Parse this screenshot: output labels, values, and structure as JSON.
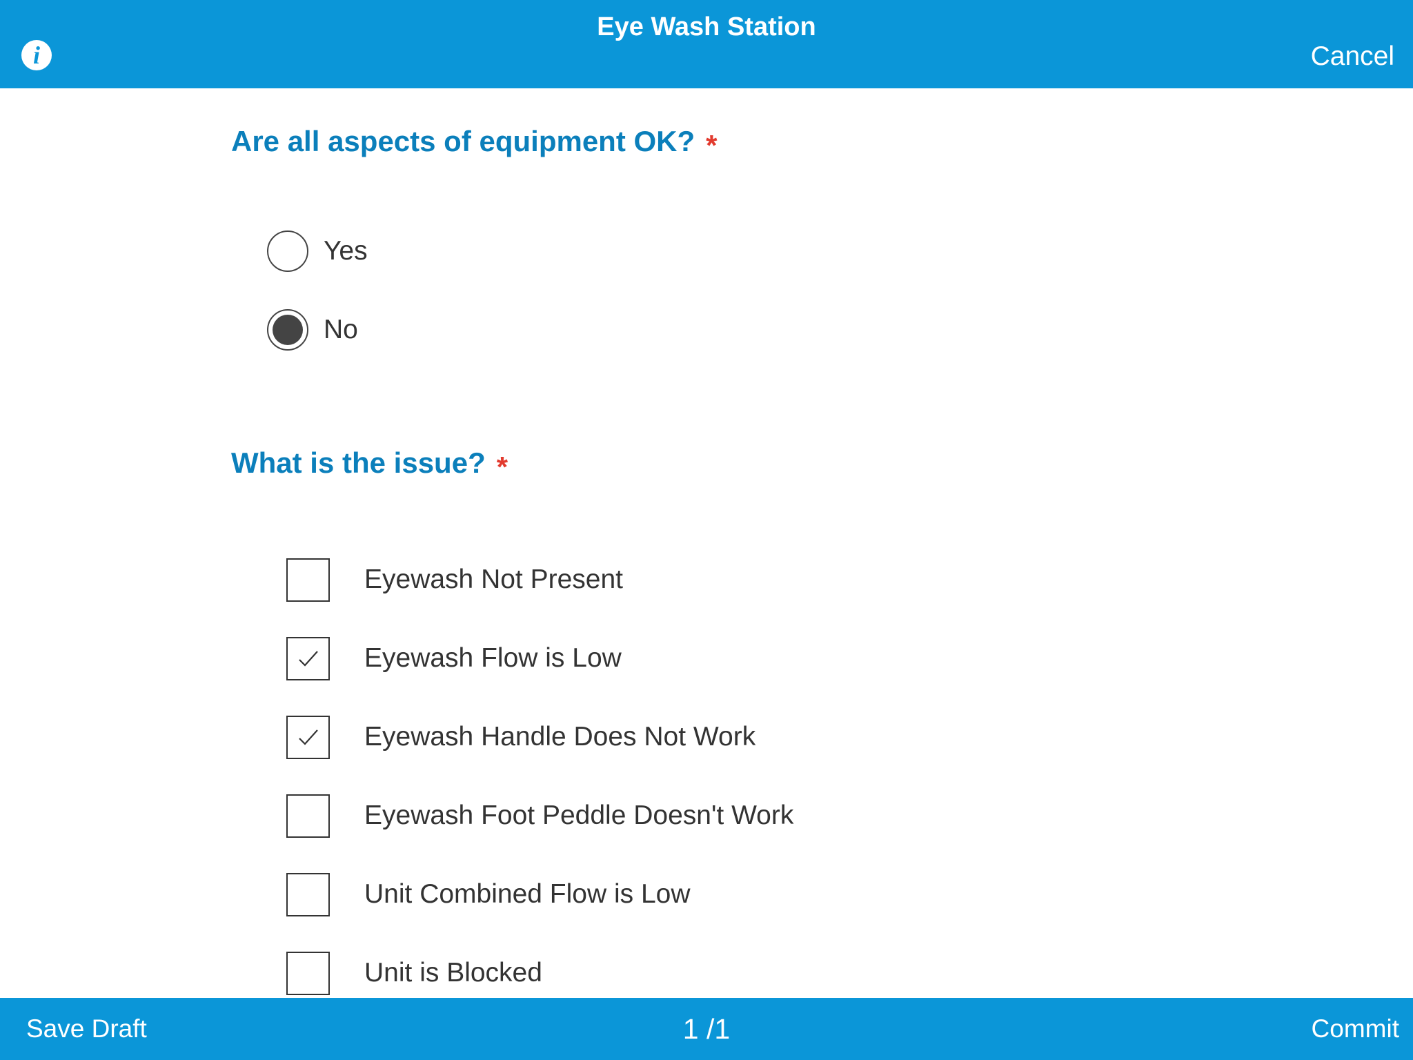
{
  "header": {
    "title": "Eye Wash Station",
    "info_icon": "info-icon",
    "info_glyph": "i",
    "cancel_label": "Cancel"
  },
  "questions": [
    {
      "label": "Are all aspects of equipment OK?",
      "required_mark": "*",
      "type": "radio",
      "options": [
        {
          "label": "Yes",
          "selected": false
        },
        {
          "label": "No",
          "selected": true
        }
      ]
    },
    {
      "label": "What is the issue?",
      "required_mark": "*",
      "type": "checkbox",
      "options": [
        {
          "label": "Eyewash Not Present",
          "checked": false
        },
        {
          "label": "Eyewash Flow is Low",
          "checked": true
        },
        {
          "label": "Eyewash Handle Does Not Work",
          "checked": true
        },
        {
          "label": "Eyewash Foot Peddle Doesn't Work",
          "checked": false
        },
        {
          "label": "Unit Combined Flow is Low",
          "checked": false
        },
        {
          "label": "Unit is Blocked",
          "checked": false
        }
      ]
    }
  ],
  "footer": {
    "save_draft_label": "Save Draft",
    "page_indicator": "1 /1",
    "commit_label": "Commit"
  },
  "colors": {
    "brand_blue": "#0b96d8",
    "question_blue": "#0b7fbb",
    "required_red": "#e23a2e"
  }
}
